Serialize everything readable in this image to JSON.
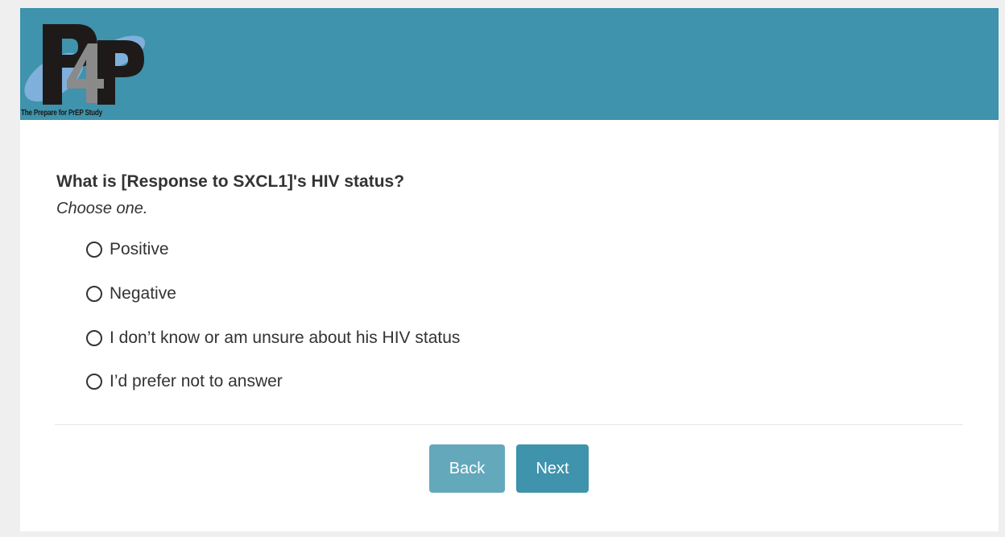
{
  "header": {
    "logo_text": "P4P",
    "logo_caption": "The Prepare for PrEP Study",
    "background_color": "#3f93ac"
  },
  "question": {
    "text": "What is [Response to SXCL1]'s HIV status?",
    "instruction": "Choose one.",
    "options": [
      {
        "label": "Positive",
        "selected": false
      },
      {
        "label": "Negative",
        "selected": false
      },
      {
        "label": "I don’t know or am unsure about his HIV status",
        "selected": false
      },
      {
        "label": "I’d prefer not to answer",
        "selected": false
      }
    ]
  },
  "navigation": {
    "back_label": "Back",
    "next_label": "Next",
    "back_color": "#64a8bc",
    "next_color": "#3f93ac"
  }
}
